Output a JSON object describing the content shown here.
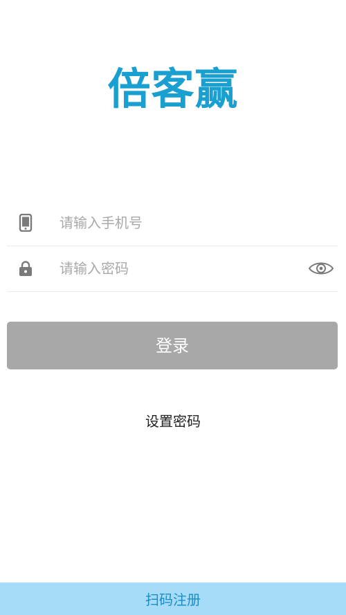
{
  "app": {
    "logo_text": "倍客赢"
  },
  "login_form": {
    "phone": {
      "icon": "mobile-phone-icon",
      "placeholder": "请输入手机号",
      "value": ""
    },
    "password": {
      "icon": "lock-icon",
      "placeholder": "请输入密码",
      "value": "",
      "toggle_icon": "eye-icon"
    },
    "login_label": "登录",
    "set_password_label": "设置密码"
  },
  "footer": {
    "scan_register_label": "扫码注册"
  },
  "colors": {
    "brand": "#1a9fd1",
    "button_disabled": "#a8a8a8",
    "footer_bar": "#a6dcf8",
    "footer_text": "#1b8ec6",
    "icon_gray": "#7a7a7a"
  }
}
